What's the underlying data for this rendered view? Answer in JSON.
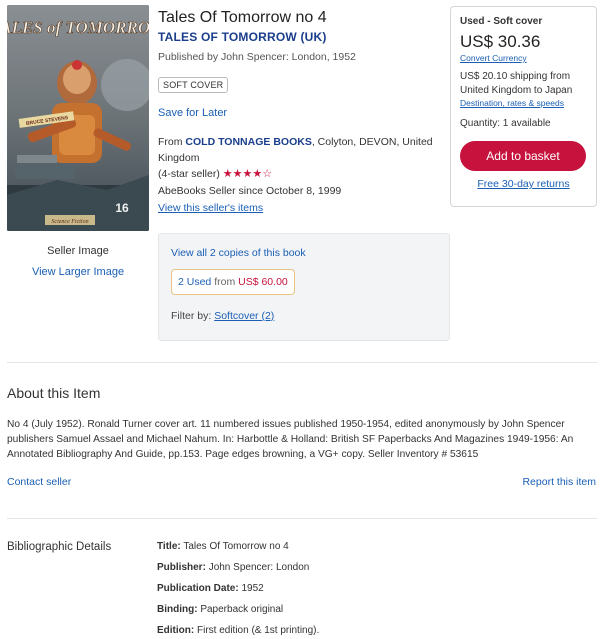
{
  "cover": {
    "image_title": "TALES of TOMORROW",
    "image_byline": "BRUCE STEVENS",
    "image_number": "16",
    "image_imprint": "Science Fiction"
  },
  "seller_image_label": "Seller Image",
  "view_larger_label": "View Larger Image",
  "book": {
    "title": "Tales Of Tomorrow no 4",
    "author": "TALES OF TOMORROW (UK)",
    "published": "Published by John Spencer: London, 1952",
    "binding_badge": "SOFT COVER",
    "save_for_later": "Save for Later"
  },
  "seller": {
    "from_prefix": "From",
    "name": "COLD TONNAGE BOOKS",
    "location": ", Colyton, DEVON, United Kingdom",
    "rating_label": "(4-star seller)",
    "stars": "★★★★☆",
    "since": "AbeBooks Seller since October 8, 1999",
    "view_items": "View this seller's items"
  },
  "copies": {
    "view_all": "View all 2 copies of this book",
    "used_count": "2 Used",
    "from_word": "from",
    "from_price": "US$ 60.00",
    "filter_label": "Filter by:",
    "filter_value": "Softcover (2)"
  },
  "buy_box": {
    "condition": "Used - Soft cover",
    "price": "US$ 30.36",
    "convert_currency": "Convert Currency",
    "shipping": "US$ 20.10 shipping from United Kingdom to Japan",
    "destination_link": "Destination, rates & speeds",
    "quantity": "Quantity: 1 available",
    "add_to_basket": "Add to basket",
    "free_returns": "Free 30-day returns"
  },
  "about": {
    "heading": "About this Item",
    "description": "No 4 (July 1952). Ronald Turner cover art. 11 numbered issues published 1950-1954, edited anonymously by John Spencer publishers Samuel Assael and Michael Nahum. In: Harbottle & Holland: British SF Paperbacks And Magazines 1949-1956: An Annotated Bibliography And Guide, pp.153. Page edges browning, a VG+ copy. Seller Inventory # 53615",
    "contact_seller": "Contact seller",
    "report_item": "Report this item"
  },
  "biblio": {
    "heading": "Bibliographic Details",
    "rows": [
      {
        "key": "Title:",
        "value": "Tales Of Tomorrow no 4"
      },
      {
        "key": "Publisher:",
        "value": "John Spencer: London"
      },
      {
        "key": "Publication Date:",
        "value": "1952"
      },
      {
        "key": "Binding:",
        "value": "Paperback original"
      },
      {
        "key": "Edition:",
        "value": "First edition (& 1st printing)."
      }
    ]
  },
  "colors": {
    "accent_red": "#c6123c",
    "link_blue": "#1a5fb4",
    "author_navy": "#1a3e8c"
  }
}
